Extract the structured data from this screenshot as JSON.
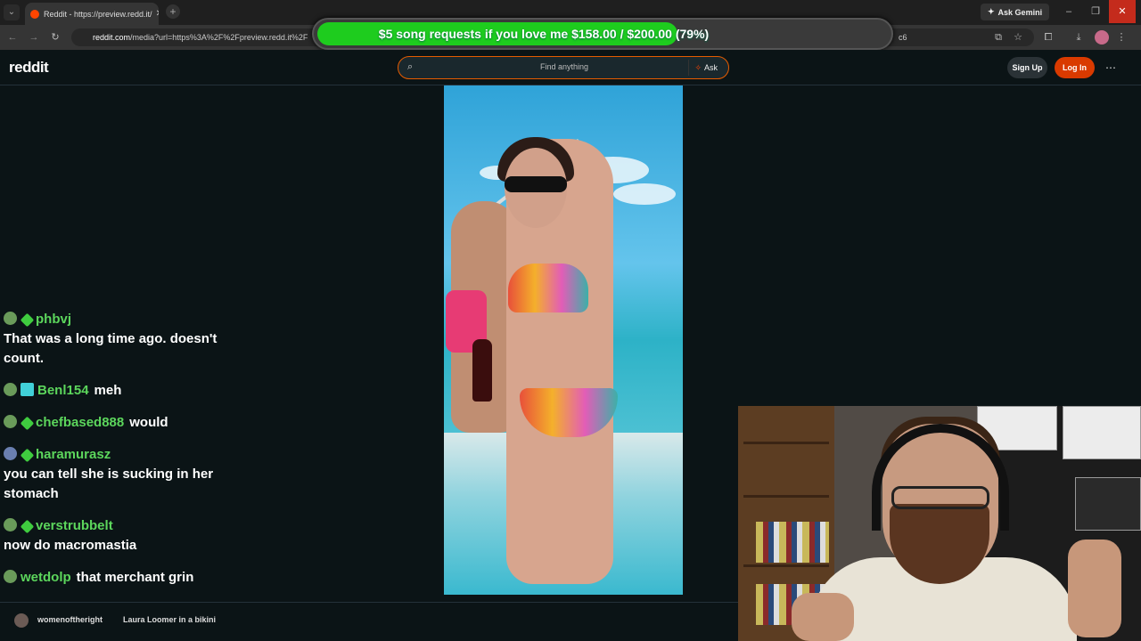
{
  "browser": {
    "tab_title": "Reddit - https://preview.redd.it/",
    "tab_close": "✕",
    "new_tab": "+",
    "ask_gemini": "Ask Gemini",
    "url_host": "reddit.com",
    "url_rest": "/media?url=https%3A%2F%2Fpreview.redd.it%2F",
    "url_tail": "c6"
  },
  "donation": {
    "text": "$5 song requests if you love me $158.00 / $200.00 (79%)",
    "progress_fraction": 0.79
  },
  "reddit": {
    "logo": "reddit",
    "search_placeholder": "Find anything",
    "ask_label": "Ask",
    "signup_label": "Sign Up",
    "login_label": "Log In",
    "more_label": "⋯"
  },
  "chat": [
    {
      "name": "phbvj",
      "text": "That was a long time ago. doesn't count.",
      "badges": [
        "globe",
        "diamond"
      ],
      "newline": true
    },
    {
      "name": "Benl154",
      "text": "meh",
      "badges": [
        "globe",
        "gift"
      ],
      "newline": false
    },
    {
      "name": "chefbased888",
      "text": "would",
      "badges": [
        "globe",
        "diamond"
      ],
      "newline": false
    },
    {
      "name": "haramurasz",
      "text": "you can tell she is sucking in her stomach",
      "badges": [
        "hat",
        "diamond"
      ],
      "newline": true
    },
    {
      "name": "verstrubbelt",
      "text": "now do macromastia",
      "badges": [
        "globe",
        "diamond"
      ],
      "newline": true
    },
    {
      "name": "wetdolp",
      "text": "that merchant grin",
      "badges": [
        "globe"
      ],
      "newline": false
    }
  ],
  "bottom": {
    "subreddit": "womenoftheright",
    "post_title": "Laura Loomer in a bikini"
  },
  "icons": {
    "search": "search-icon",
    "window_close": "close-icon"
  }
}
